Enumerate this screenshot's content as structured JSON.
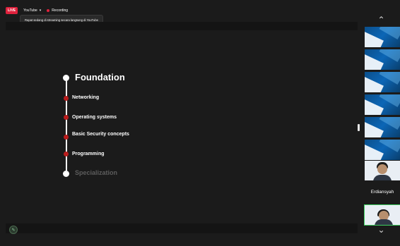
{
  "top_bar": {
    "live_badge": "LIVE",
    "platform": "YouTube",
    "recording": "Recording"
  },
  "toast": {
    "text": "Rapat sedang di streaming secara langsung di YouTube"
  },
  "slide": {
    "items": [
      {
        "label": "Foundation"
      },
      {
        "label": "Networking"
      },
      {
        "label": "Operating systems"
      },
      {
        "label": "Basic Security concepts"
      },
      {
        "label": "Programming"
      },
      {
        "label": "Specialization"
      }
    ]
  },
  "participants": {
    "visible_name": "Erdiansyah"
  },
  "icons": {
    "chevron_up": "chevron-up-icon",
    "chevron_down": "chevron-down-icon",
    "pencil": "pencil-icon",
    "record_dot": "record-dot-icon"
  },
  "colors": {
    "live_red": "#e0223d",
    "accent_green": "#3fcf60",
    "timeline_red": "#b91d1d"
  }
}
